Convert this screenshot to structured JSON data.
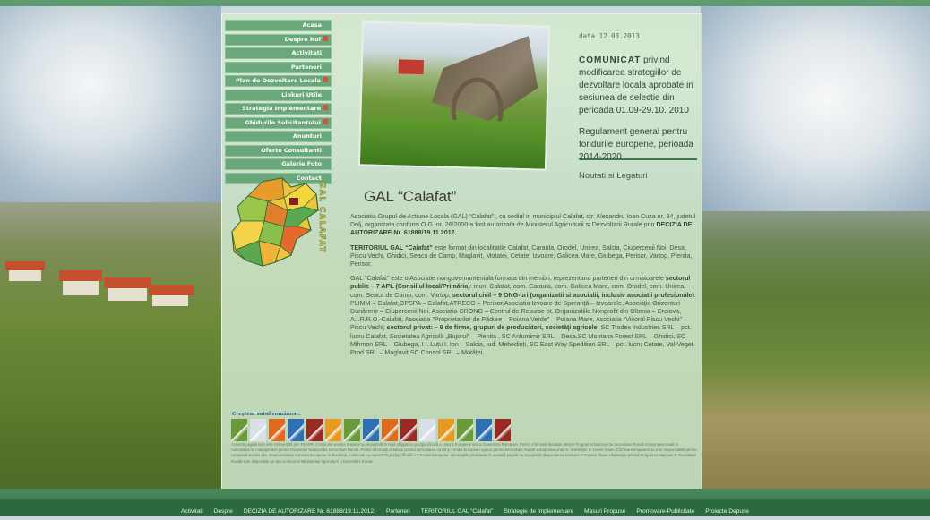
{
  "menu": [
    {
      "label": "Acasa",
      "has_sub": false
    },
    {
      "label": "Despre Noi",
      "has_sub": true
    },
    {
      "label": "Activitati",
      "has_sub": false
    },
    {
      "label": "Parteneri",
      "has_sub": false
    },
    {
      "label": "Plan de Dezvoltare Locala",
      "has_sub": true
    },
    {
      "label": "Linkuri Utile",
      "has_sub": false
    },
    {
      "label": "Strategia Implementare",
      "has_sub": true
    },
    {
      "label": "Ghidurile Solicitantului",
      "has_sub": true
    },
    {
      "label": "Anunturi",
      "has_sub": false
    },
    {
      "label": "Oferte Consultanti",
      "has_sub": false
    },
    {
      "label": "Galerie Foto",
      "has_sub": false
    },
    {
      "label": "Contact",
      "has_sub": false
    }
  ],
  "side": {
    "date": "data 12.03.2013",
    "comm_title": "COMUNICAT",
    "comm_text": " privind modificarea strategiilor de dezvoltare locala aprobate in sesiunea de selectie din perioada 01.09-29.10. 2010",
    "regulament": "Regulament general pentru fondurile europene, perioada 2014-2020",
    "noutati": "Noutati si Legaturi"
  },
  "logo_text": "GAL CALAFAT",
  "title": "GAL “Calafat”",
  "p1_a": "Asociatia Grupul de Actiune Locala (GAL) “Calafat” ,  cu sediul in municipiul Calafat, str. Alexandru Ioan Cuza nr. 34, judetul Dolj, organizata conform O.G. nr. 26/2000 a fost autorizata de Ministerul Agriculturii si Dezvoltarii Rurale prin ",
  "p1_b": "DECIZIA DE AUTORIZARE Nr. 61888/19.11.2012.",
  "p2_a": "TERITORIUL GAL “Calafat”",
  "p2_b": "  este format din localitatile Calafat, Caraula,  Orodel, Unirea,  Salcia, Ciupercenii Noi,  Desa, Piscu Vechi, Ghidici, Seaca de Camp, Maglavit, Motatei, Cetate, Izvoare, Galicea Mare, Giubega, Perisor, Vartop, Plenita, Perisor.",
  "p3_a": "GAL \"Calafat\" este o Asociatie nonguvernamentala formata din membri, reprezentand parteneri din urmatoarele ",
  "p3_b": "sectorul public –  7 APL (Consiliul local/Primăria)",
  "p3_c": ": mun. Calafat,  com. Caraula,  com. Galicea Mare,  com. Orodel, com. Unirea,  com. Seaca de Camp,  com. Vartop; ",
  "p3_d": "sectorul civil – 9  ONG-uri (organizatii si asociatii, inclusiv asociatii profesionale)",
  "p3_e": ": PLIMM – Calafat,OPSPA – Calafat,ATRECO – Perisor,Asociatia Izvoare de  Speranţă – Izvoarele, Asociaţia Orizonturi Dunărene – Ciupercenii Noi, Asociaţia CRONO – Centrul de Resurse pt. Organizatiile Nonprofit din Oltenia – Craiova, A.I.R.R.O.-Calafat, Asociatia \"Proprietarilor de Pădure – Poiana Verde\" – Poiana Mare, Asociatia \"Viitorul Piscu Vechi\" – Piscu Vechi; ",
  "p3_f": "sectorul privat: – 9 de firme, grupuri de producători, societăţi agricole",
  "p3_g": ": SC Tradex Industries SRL – pct. lucru Calafat, Societatea Agricolă „Bujorul\" – Plenita , SC  Anlumimir SRL – Desa,SC Montana Forest SRL – Ghidici, SC Mihmon SRL – Giubega, I.I.  Luțu I. Ion –  Salcia, jud. Mehedinți, SC East Way Spedition SRL – pct. lucru Cetate,  Val-Veget Prod SRL – Maglavit SC Consol SRL – Motăţei.",
  "strip_label": "Creştem satul românesc.",
  "strip_colors": [
    "#6a9b3a",
    "#d8dfe8",
    "#e06a1e",
    "#2f6fb3",
    "#9a2b24",
    "#e79a1f",
    "#6a9b3a",
    "#2f6fb3",
    "#e06a1e",
    "#9a2b24",
    "#d8dfe8",
    "#e79a1f",
    "#6a9b3a",
    "#2f6fb3",
    "#9a2b24"
  ],
  "fine_print": "Această pagină web este cofinanţată prin FEADR. Conţinutul acestui material nu reprezintă în mod obligatoriu poziţia oficială a Uniunii Europene sau a Guvernului României. Pentru informații detaliate despre Programul Național de Dezvoltare Rurală vizitați www.madr.ro. Autoritatea de management pentru Programul Naţional de Dezvoltare Rurală. Pentru informaţii detaliate privind dezvoltarea rurală şi Fondul European Agricol pentru Dezvoltare Rurală vizitaţi www.pndr.ro. Investeşte în zonele rurale. Comisia Europeană nu este responsabilă pentru conţinutul acestui site. Reprezentanţa Comisiei Europene în România. Acest site nu reprezintă poziţia oficială a Comisiei Europene. Informaţiile prezentate în această pagină nu angajează răspunderea Comisiei Europene. Toate informaţiile privind Programul Naţional de Dezvoltare Rurală sunt disponibile pe site-ul oficial al Ministerului Agriculturii şi Dezvoltării Rurale.",
  "footer": [
    "Activitati",
    "Despre",
    "DECIZIA DE AUTORIZARE Nr. 61888/19.11.2012.",
    "Parteneri",
    "TERITORIUL GAL “Calafat”",
    "Strategie de Implementare",
    "Masuri Propuse",
    "Promovare-Publicitate",
    "Proiecte Depuse"
  ]
}
